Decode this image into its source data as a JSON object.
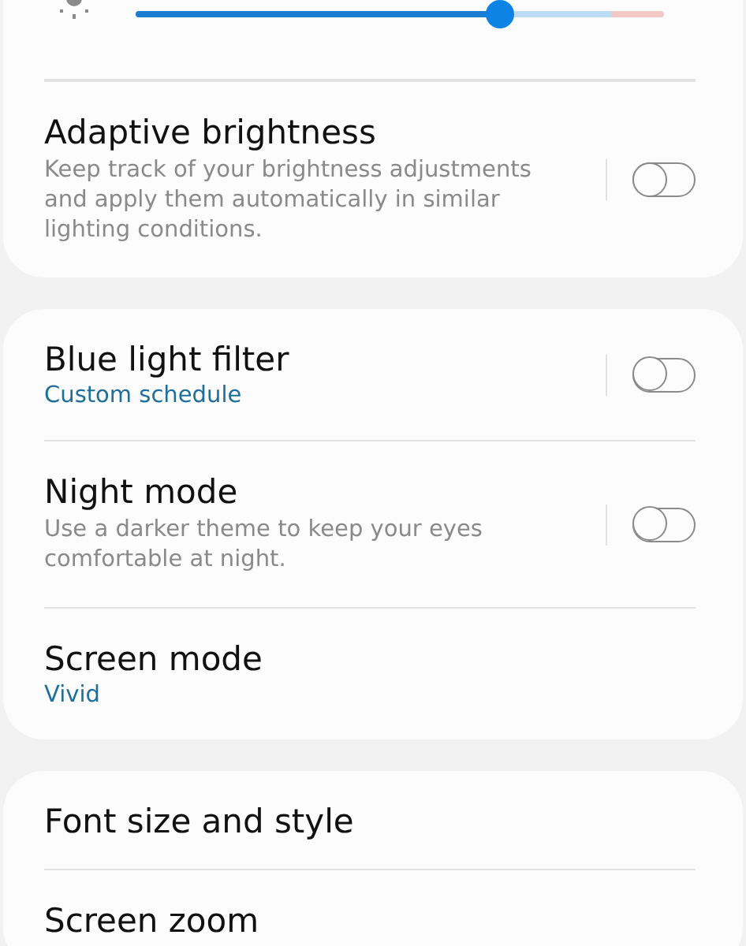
{
  "brightness": {
    "level": 0.69
  },
  "cards": [
    {
      "items": [
        {
          "kind": "toggle",
          "title": "Adaptive brightness",
          "description": "Keep track of your brightness adjustments and apply them automatically in similar lighting conditions.",
          "on": false
        }
      ]
    },
    {
      "items": [
        {
          "kind": "toggle",
          "title": "Blue light filter",
          "subtitle": "Custom schedule",
          "on": false
        },
        {
          "kind": "toggle",
          "title": "Night mode",
          "description": "Use a darker theme to keep your eyes comfortable at night.",
          "on": false
        },
        {
          "kind": "link",
          "title": "Screen mode",
          "subtitle": "Vivid"
        }
      ]
    },
    {
      "items": [
        {
          "kind": "link",
          "title": "Font size and style"
        },
        {
          "kind": "link",
          "title": "Screen zoom"
        }
      ]
    }
  ]
}
